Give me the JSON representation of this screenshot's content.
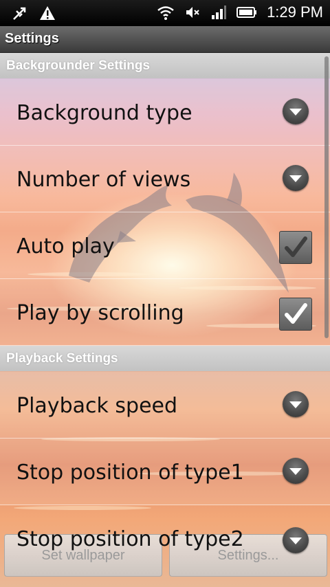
{
  "status_bar": {
    "left_icons": [
      "usb-debug-icon",
      "warning-icon"
    ],
    "right_icons": [
      "wifi-icon",
      "volume-muted-icon",
      "signal-icon",
      "battery-icon"
    ],
    "time": "1:29 PM"
  },
  "title_bar": {
    "title": "Settings"
  },
  "sections": [
    {
      "header": "Backgrounder Settings",
      "items": [
        {
          "label": "Background type",
          "control": "dropdown"
        },
        {
          "label": "Number of views",
          "control": "dropdown"
        },
        {
          "label": "Auto play",
          "control": "checkbox",
          "checked": true
        },
        {
          "label": "Play by scrolling",
          "control": "checkbox",
          "checked": true
        }
      ]
    },
    {
      "header": "Playback Settings",
      "items": [
        {
          "label": "Playback speed",
          "control": "dropdown"
        },
        {
          "label": "Stop position of type1",
          "control": "dropdown"
        },
        {
          "label": "Stop position of type2",
          "control": "dropdown"
        }
      ]
    }
  ],
  "bottom_buttons": {
    "set_wallpaper": "Set wallpaper",
    "settings": "Settings..."
  }
}
